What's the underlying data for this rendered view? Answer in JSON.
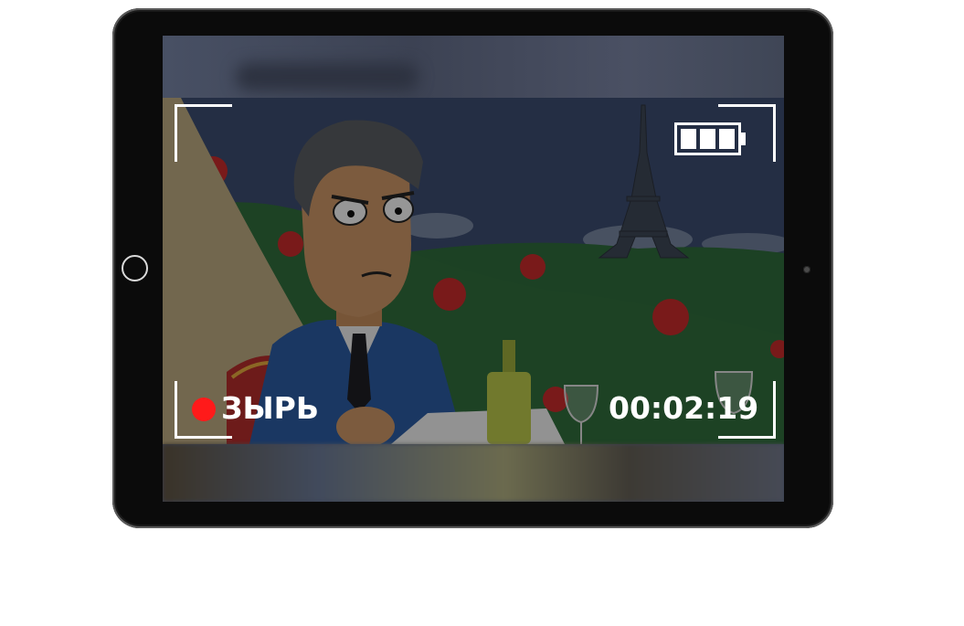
{
  "recorder": {
    "status_label": "ЗЫРЬ",
    "timecode": "00:02:19",
    "battery_level_bars": 3,
    "battery_capacity_bars": 3,
    "rec_color": "#ff1a1a"
  },
  "device": {
    "type": "tablet",
    "icons": [
      "home-button-icon",
      "front-camera-icon",
      "battery-icon",
      "record-dot-icon"
    ]
  },
  "scene": {
    "description_icons": [
      "eiffel-tower-icon",
      "rose-icon",
      "wine-bottle-icon",
      "wine-glass-icon"
    ]
  }
}
